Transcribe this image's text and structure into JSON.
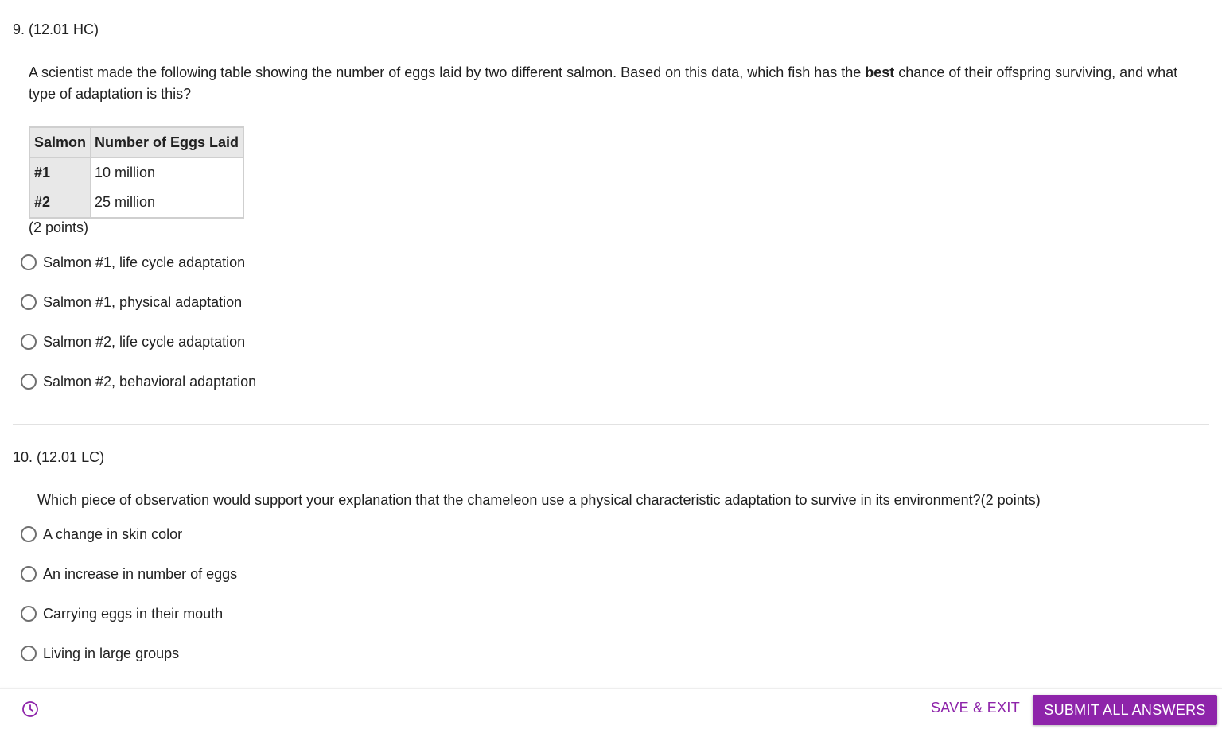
{
  "q9": {
    "header": "9. (12.01 HC)",
    "text_part1": "A scientist made the following table showing the number of eggs laid by two different salmon. Based on this data, which fish has the ",
    "text_bold": "best",
    "text_part2": " chance of their offspring surviving, and what type of adaptation is this?",
    "table": {
      "headers": [
        "Salmon",
        "Number of Eggs Laid"
      ],
      "rows": [
        [
          "#1",
          "10 million"
        ],
        [
          "#2",
          "25 million"
        ]
      ]
    },
    "points": "(2 points)",
    "options": [
      "Salmon #1, life cycle adaptation",
      "Salmon #1, physical adaptation",
      "Salmon #2, life cycle adaptation",
      "Salmon #2, behavioral adaptation"
    ]
  },
  "q10": {
    "header": "10. (12.01 LC)",
    "text": "Which piece of observation would support your explanation that the chameleon use a physical characteristic adaptation to survive in its environment?(2 points)",
    "options": [
      "A change in skin color",
      "An increase in number of eggs",
      "Carrying eggs in their mouth",
      "Living in large groups"
    ]
  },
  "footer": {
    "clock_icon": "clock-icon",
    "save_exit_label": "SAVE & EXIT",
    "submit_label": "SUBMIT ALL ANSWERS",
    "accent_color": "#8e24aa"
  }
}
